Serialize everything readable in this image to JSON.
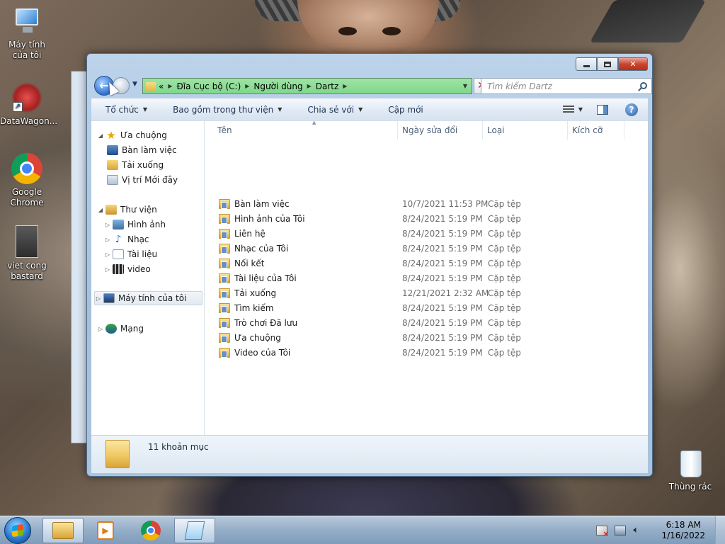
{
  "desktop": {
    "icons": [
      {
        "label": "Máy tính của tôi",
        "icon": "computer-icon"
      },
      {
        "label": "DataWagon...",
        "icon": "datawagon-shortcut-icon"
      },
      {
        "label": "Google Chrome",
        "icon": "chrome-icon"
      },
      {
        "label": "viet cong bastard",
        "icon": "image-file-icon"
      },
      {
        "label": "Thùng rác",
        "icon": "recycle-bin-icon"
      }
    ]
  },
  "window": {
    "address": {
      "prefix": "«",
      "crumbs": [
        "Đĩa Cục bộ (C:)",
        "Người dùng",
        "Dartz"
      ]
    },
    "search_placeholder": "Tìm kiếm Dartz",
    "commands": [
      "Tổ chức",
      "Bao gồm trong thư viện",
      "Chia sẻ với",
      "Cập mới"
    ],
    "nav": {
      "favorites": {
        "label": "Ưa chuộng",
        "items": [
          "Bàn làm việc",
          "Tải xuống",
          "Vị trí Mới đây"
        ]
      },
      "libraries": {
        "label": "Thư viện",
        "items": [
          "Hình ảnh",
          "Nhạc",
          "Tài liệu",
          "video"
        ]
      },
      "computer": "Máy tính của tôi",
      "network": "Mạng"
    },
    "columns": [
      "Tên",
      "Ngày sửa đổi",
      "Loại",
      "Kích cỡ"
    ],
    "files": [
      {
        "name": "Bàn làm việc",
        "date": "10/7/2021 11:53 PM",
        "type": "Cặp tệp"
      },
      {
        "name": "Hình ảnh của Tôi",
        "date": "8/24/2021 5:19 PM",
        "type": "Cặp tệp"
      },
      {
        "name": "Liên hệ",
        "date": "8/24/2021 5:19 PM",
        "type": "Cặp tệp"
      },
      {
        "name": "Nhạc của Tôi",
        "date": "8/24/2021 5:19 PM",
        "type": "Cặp tệp"
      },
      {
        "name": "Nối kết",
        "date": "8/24/2021 5:19 PM",
        "type": "Cặp tệp"
      },
      {
        "name": "Tài liệu của Tôi",
        "date": "8/24/2021 5:19 PM",
        "type": "Cặp tệp"
      },
      {
        "name": "Tải xuống",
        "date": "12/21/2021 2:32 AM",
        "type": "Cặp tệp"
      },
      {
        "name": "Tìm kiếm",
        "date": "8/24/2021 5:19 PM",
        "type": "Cặp tệp"
      },
      {
        "name": "Trò chơi Đã lưu",
        "date": "8/24/2021 5:19 PM",
        "type": "Cặp tệp"
      },
      {
        "name": "Ưa chuộng",
        "date": "8/24/2021 5:19 PM",
        "type": "Cặp tệp"
      },
      {
        "name": "Video của Tôi",
        "date": "8/24/2021 5:19 PM",
        "type": "Cặp tệp"
      }
    ],
    "status": "11 khoản mục"
  },
  "taskbar": {
    "apps": [
      "windows-explorer-icon",
      "media-player-icon",
      "chrome-icon",
      "notepad-icon"
    ],
    "time": "6:18 AM",
    "date": "1/16/2022"
  }
}
